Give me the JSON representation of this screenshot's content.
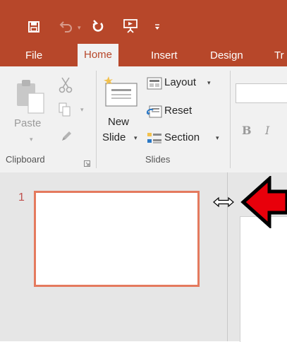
{
  "ribbon_tabs": [
    "File",
    "Home",
    "Insert",
    "Design",
    "Tr"
  ],
  "active_tab": "Home",
  "quick_access": {
    "save_icon": "save-icon",
    "undo_icon": "undo-icon",
    "redo_icon": "repeat-icon",
    "present_icon": "present-from-beginning-icon",
    "customize_icon": "customize-qat-icon"
  },
  "clipboard": {
    "paste_label": "Paste",
    "group_label": "Clipboard"
  },
  "slides_group": {
    "new_slide_label_1": "New",
    "new_slide_label_2": "Slide",
    "layout_label": "Layout",
    "reset_label": "Reset",
    "section_label": "Section",
    "group_label": "Slides"
  },
  "font_group": {
    "bold_label": "B",
    "italic_label": "I"
  },
  "thumbnail_pane": {
    "slide_number": "1"
  },
  "colors": {
    "brand": "#b7472a",
    "thumb_border": "#e47a5e",
    "annotation_arrow": "#e8000b"
  }
}
